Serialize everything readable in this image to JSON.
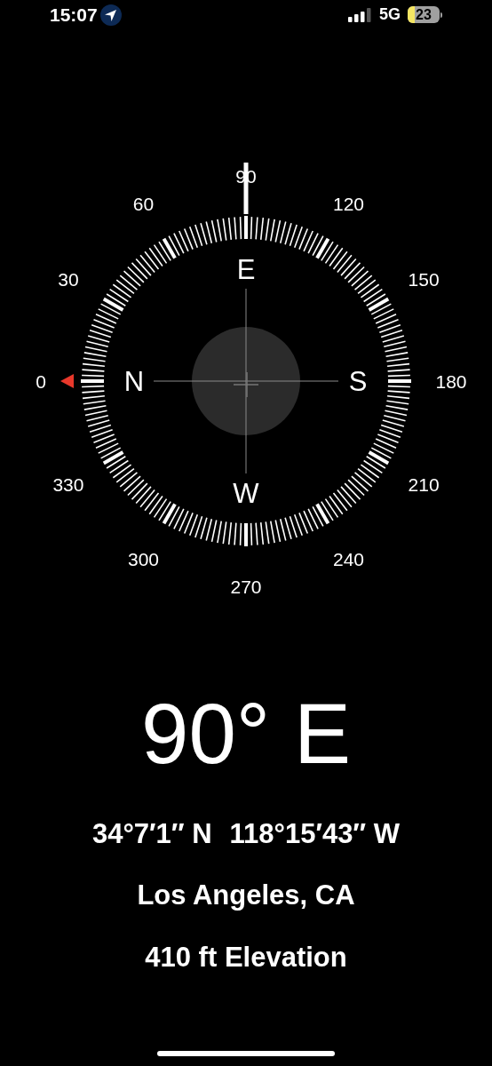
{
  "status_bar": {
    "time": "15:07",
    "location_active": true,
    "network": "5G",
    "battery": "23",
    "low_power_mode": true
  },
  "compass": {
    "degree_labels": [
      "0",
      "30",
      "60",
      "90",
      "120",
      "150",
      "180",
      "210",
      "240",
      "270",
      "300",
      "330"
    ],
    "cardinals": [
      "N",
      "E",
      "S",
      "W"
    ],
    "north_marker": true
  },
  "heading": "90° E",
  "coordinates": [
    "34°7′1″ N",
    "118°15′43″ W"
  ],
  "city": "Los Angeles, CA",
  "elevation": "410 ft Elevation"
}
